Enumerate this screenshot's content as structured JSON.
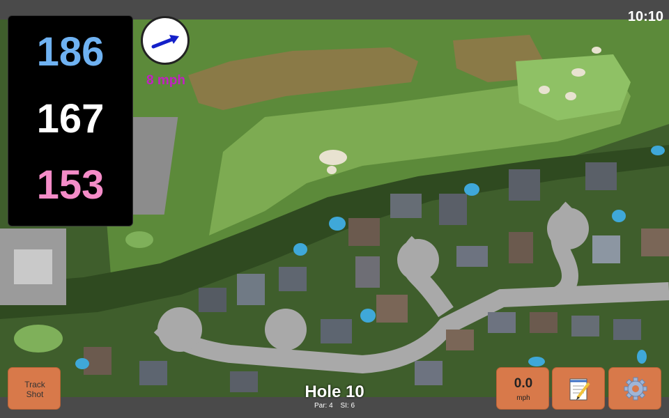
{
  "status": {
    "time": "10:10"
  },
  "distances": {
    "back": "186",
    "middle": "167",
    "front": "153"
  },
  "wind": {
    "speed": "8 mph",
    "icon": "wind-arrow-icon"
  },
  "buttons": {
    "track_shot_line1": "Track",
    "track_shot_line2": "Shot",
    "speed_value": "0.0",
    "speed_unit": "mph",
    "notes_icon": "notepad-icon",
    "settings_icon": "gear-icon"
  },
  "hole": {
    "title": "Hole 10",
    "par_label": "Par: 4",
    "si_label": "SI: 6"
  },
  "colors": {
    "back": "#6fb2f2",
    "middle": "#ffffff",
    "front": "#f48cc8",
    "wind_text": "#c31fc3",
    "button": "#d8794a"
  }
}
